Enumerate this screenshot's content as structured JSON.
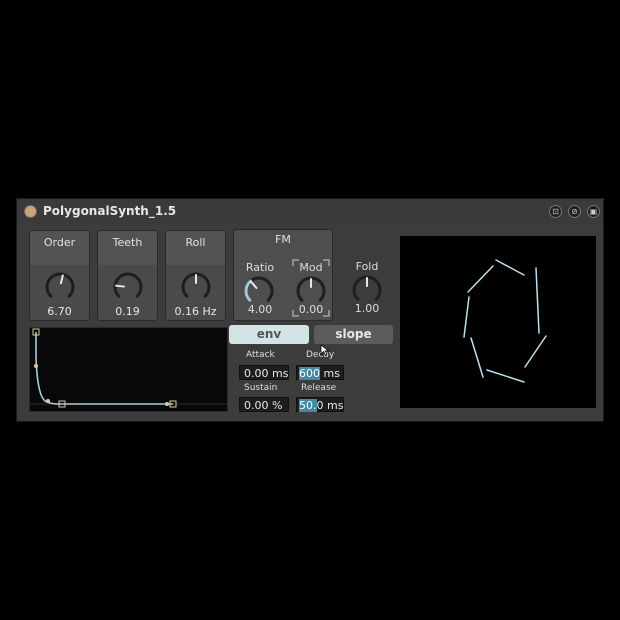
{
  "device": {
    "title": "PolygonalSynth_1.5",
    "buttons": [
      {
        "name": "fit-icon",
        "glyph": "⊡"
      },
      {
        "name": "link-icon",
        "glyph": "⊘"
      },
      {
        "name": "save-icon",
        "glyph": "▣"
      }
    ]
  },
  "controls": {
    "order": {
      "label": "Order",
      "value": "6.70",
      "level": 0.55
    },
    "teeth": {
      "label": "Teeth",
      "value": "0.19",
      "level": 0.19
    },
    "roll": {
      "label": "Roll",
      "value": "0.16 Hz",
      "level": 0.5
    },
    "fm": {
      "label": "FM",
      "ratio": {
        "label": "Ratio",
        "value": "4.00",
        "level": 0.35
      },
      "mod": {
        "label": "Mod",
        "value": "0.00",
        "level": 0.5
      }
    },
    "fold": {
      "label": "Fold",
      "value": "1.00",
      "level": 0.5
    }
  },
  "envelope": {
    "tabs": {
      "env": "env",
      "slope": "slope"
    },
    "active_tab": "env",
    "attack": {
      "label": "Attack",
      "value": "0.00 ms"
    },
    "decay": {
      "label": "Decay",
      "value_highlight": "600",
      "value_rest": " ms"
    },
    "sustain": {
      "label": "Sustain",
      "value": "0.00 %"
    },
    "release": {
      "label": "Release",
      "value_highlight": "50.",
      "value_rest": "0 ms"
    }
  },
  "colors": {
    "accent": "#3f8aa6",
    "curve": "#9fd0dc",
    "scope_line": "#b8e4f0",
    "knob_arc": "#9fc8d8"
  }
}
